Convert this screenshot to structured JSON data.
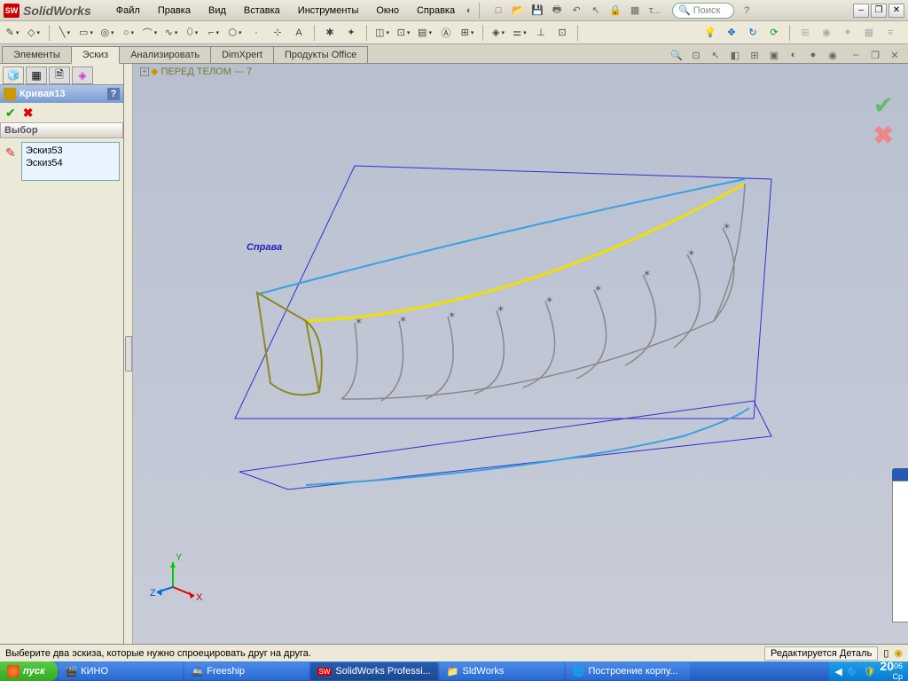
{
  "app": {
    "name": "SolidWorks"
  },
  "menu": [
    "Файл",
    "Правка",
    "Вид",
    "Вставка",
    "Инструменты",
    "Окно",
    "Справка"
  ],
  "search": {
    "placeholder": "Поиск"
  },
  "tabs": [
    "Элементы",
    "Эскиз",
    "Анализировать",
    "DimXpert",
    "Продукты Office"
  ],
  "active_tab": "Эскиз",
  "breadcrumb": "ПЕРЕД ТЕЛОМ --- 7",
  "feature_panel": {
    "title": "Кривая13",
    "section": "Выбор",
    "items": [
      "Эскиз53",
      "Эскиз54"
    ]
  },
  "plane_label": "Справа",
  "triad": {
    "x": "X",
    "y": "Y",
    "z": "Z"
  },
  "status_left": "Выберите два эскиза, которые нужно спроецировать друг на друга.",
  "status_right": "Редактируется Деталь",
  "taskbar": {
    "start": "пуск",
    "items": [
      "КИНО",
      "Freeship",
      "SolidWorks Professi...",
      "SldWorks",
      "Построение корпу..."
    ],
    "time": "20",
    "minutes": "06",
    "day": "Ср"
  }
}
